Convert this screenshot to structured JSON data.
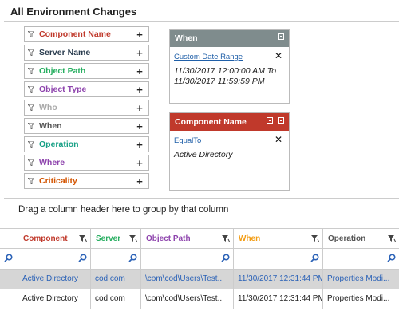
{
  "page": {
    "title": "All Environment Changes"
  },
  "filters": [
    {
      "label": "Component Name",
      "color": "#c0392b"
    },
    {
      "label": "Server Name",
      "color": "#2c3e50"
    },
    {
      "label": "Object Path",
      "color": "#27ae60"
    },
    {
      "label": "Object Type",
      "color": "#8e44ad"
    },
    {
      "label": "Who",
      "color": "#aaaaaa"
    },
    {
      "label": "When",
      "color": "#555555"
    },
    {
      "label": "Operation",
      "color": "#16a085"
    },
    {
      "label": "Where",
      "color": "#8e44ad"
    },
    {
      "label": "Criticality",
      "color": "#d35400"
    }
  ],
  "cards": {
    "when": {
      "title": "When",
      "header_color": "#7f8c8d",
      "operator": "Custom Date Range",
      "value": "11/30/2017 12:00:00 AM To 11/30/2017 11:59:59 PM"
    },
    "component": {
      "title": "Component Name",
      "header_color": "#c0392b",
      "operator": "EqualTo",
      "value": "Active Directory"
    }
  },
  "grid": {
    "group_hint": "Drag a column header here to group by that column",
    "columns": [
      {
        "label": "Component",
        "color": "#c0392b"
      },
      {
        "label": "Server",
        "color": "#27ae60"
      },
      {
        "label": "Object Path",
        "color": "#8e44ad"
      },
      {
        "label": "When",
        "color": "#f39c12"
      },
      {
        "label": "Operation",
        "color": "#555555"
      }
    ],
    "rows": [
      [
        "Active Directory",
        "cod.com",
        "\\com\\cod\\Users\\Test...",
        "11/30/2017 12:31:44 PM",
        "Properties Modi..."
      ],
      [
        "Active Directory",
        "cod.com",
        "\\com\\cod\\Users\\Test...",
        "11/30/2017 12:31:44 PM",
        "Properties Modi..."
      ]
    ]
  }
}
